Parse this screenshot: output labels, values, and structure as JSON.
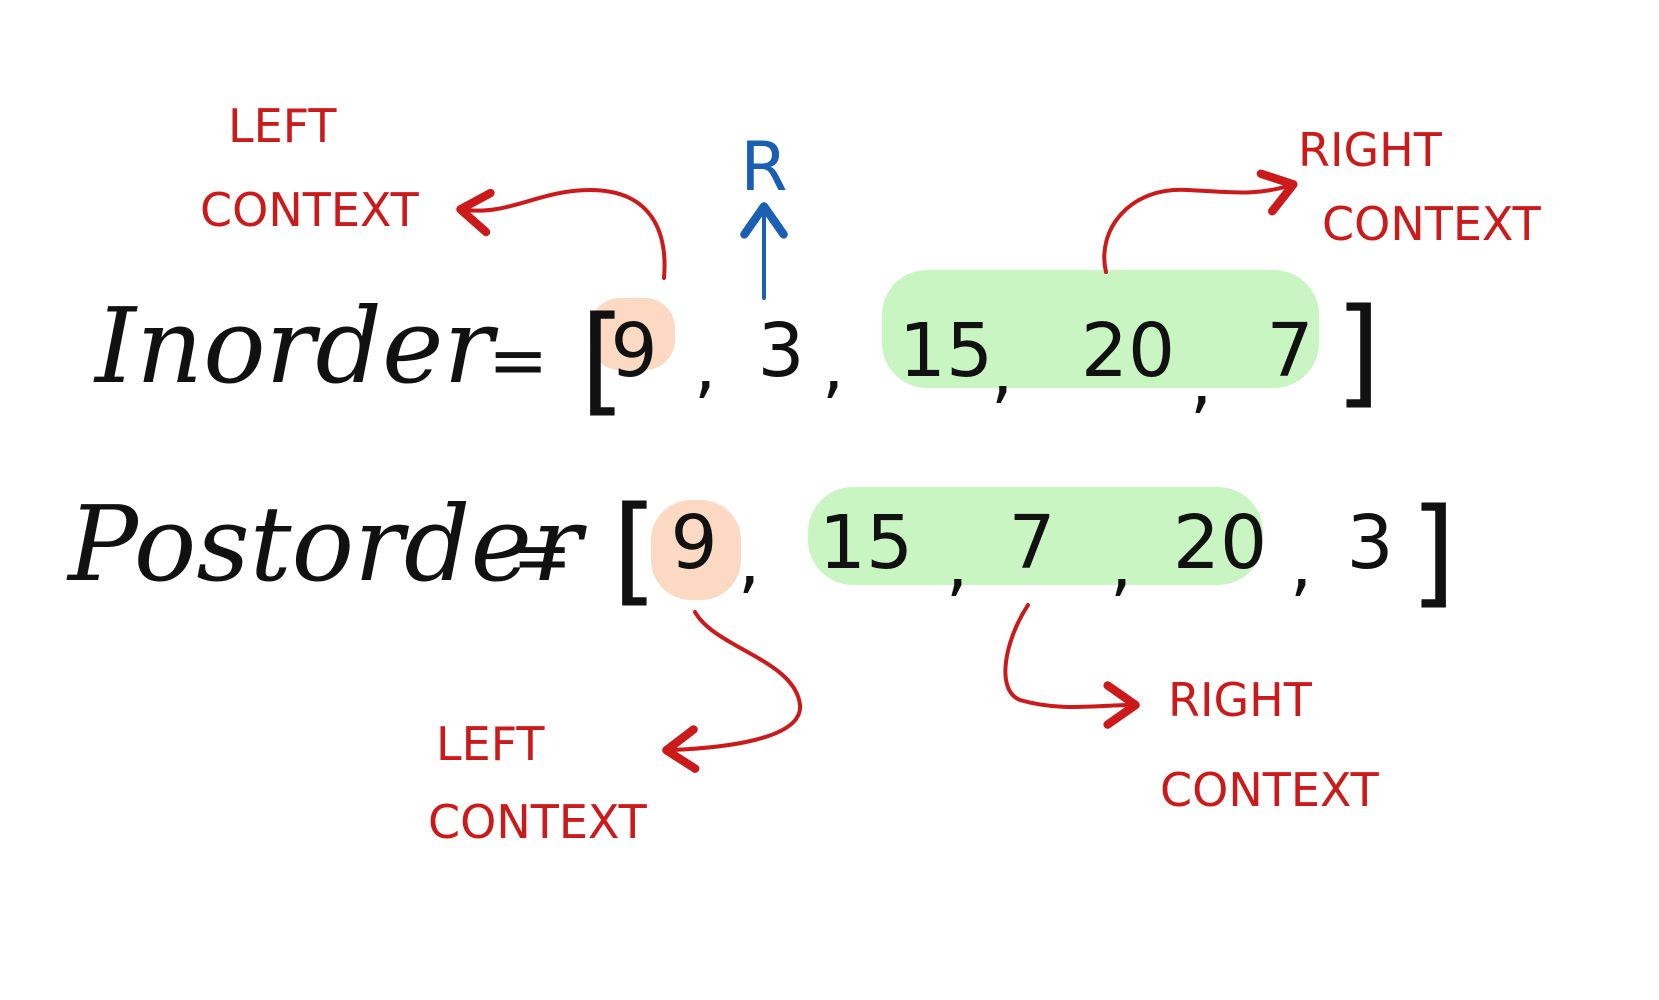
{
  "colors": {
    "ink": "#111111",
    "annotation": "#cc1a1a",
    "root_marker": "#1a5fb4",
    "left_highlight": "#fbd9c2",
    "right_highlight": "#c9f5c2"
  },
  "inorder": {
    "label": "Inorder",
    "equals": "=",
    "open_bracket": "[",
    "close_bracket": "]",
    "values": [
      "9",
      "3",
      "15",
      "20",
      "7"
    ],
    "left_highlight": [
      "9"
    ],
    "right_highlight": [
      "15",
      "20",
      "7"
    ]
  },
  "postorder": {
    "label": "Postorder",
    "equals": "=",
    "open_bracket": "[",
    "close_bracket": "]",
    "values": [
      "9",
      "15",
      "7",
      "20",
      "3"
    ],
    "left_highlight": [
      "9"
    ],
    "right_highlight": [
      "15",
      "7",
      "20"
    ]
  },
  "root_marker": {
    "label": "R",
    "icon": "up-arrow-icon"
  },
  "annotations": {
    "inorder_left": {
      "line1": "LEFT",
      "line2": "CONTEXT"
    },
    "inorder_right": {
      "line1": "RIGHT",
      "line2": "CONTEXT"
    },
    "postorder_left": {
      "line1": "LEFT",
      "line2": "CONTEXT"
    },
    "postorder_right": {
      "line1": "RIGHT",
      "line2": "CONTEXT"
    }
  }
}
